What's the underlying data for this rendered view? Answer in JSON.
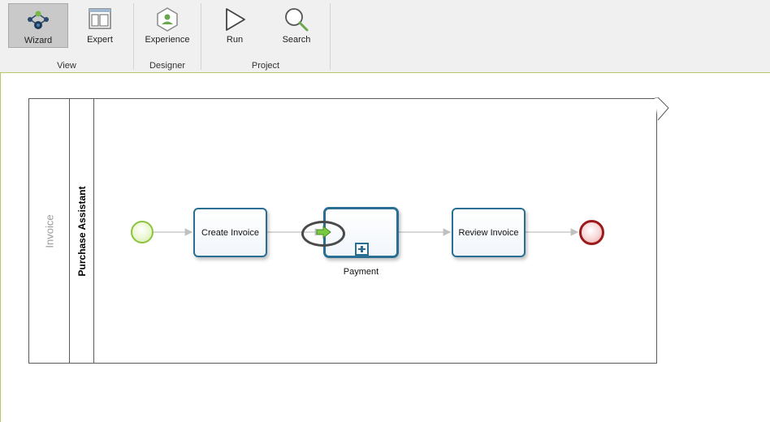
{
  "ribbon": {
    "groups": [
      {
        "label": "View",
        "buttons": [
          {
            "label": "Wizard",
            "icon": "wizard-icon",
            "active": true
          },
          {
            "label": "Expert",
            "icon": "expert-layout-icon",
            "active": false
          }
        ]
      },
      {
        "label": "Designer",
        "buttons": [
          {
            "label": "Experience",
            "icon": "experience-icon",
            "active": false
          }
        ]
      },
      {
        "label": "Project",
        "buttons": [
          {
            "label": "Run",
            "icon": "play-icon",
            "active": false
          },
          {
            "label": "Search",
            "icon": "search-icon",
            "active": false
          }
        ]
      }
    ]
  },
  "diagram": {
    "pool": {
      "name": "Invoice"
    },
    "lane": {
      "name": "Purchase Assistant"
    },
    "tasks": [
      {
        "id": "create",
        "label": "Create Invoice"
      },
      {
        "id": "payment",
        "label": "Payment",
        "type": "subprocess"
      },
      {
        "id": "review",
        "label": "Review Invoice"
      }
    ]
  },
  "colors": {
    "task_border": "#2b6e94",
    "start_event": "#8cc43c",
    "end_event": "#9b1b1b",
    "ribbon_accent": "#b5c96a",
    "flow_line": "#c0c0c0"
  }
}
